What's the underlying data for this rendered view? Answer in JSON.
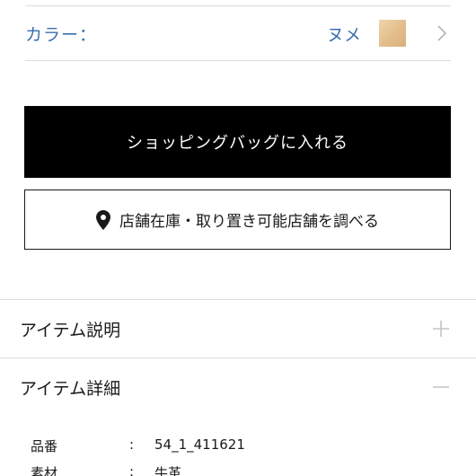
{
  "color_selector": {
    "label": "カラー：",
    "value": "ヌメ",
    "swatch_color": "#e2bd8b",
    "icon": "chevron-right-icon"
  },
  "actions": {
    "add_to_bag_label": "ショッピングバッグに入れる",
    "store_stock_label": "店舗在庫・取り置き可能店舗を調べる",
    "store_stock_icon": "location-pin-icon"
  },
  "accordions": [
    {
      "title": "アイテム説明",
      "state": "collapsed",
      "icon": "plus-icon"
    },
    {
      "title": "アイテム詳細",
      "state": "expanded",
      "icon": "minus-icon"
    }
  ],
  "item_details": [
    {
      "label": "品番",
      "separator": ":",
      "value": "54_1_411621"
    },
    {
      "label": "素材",
      "separator": ":",
      "value": "牛革"
    }
  ],
  "colors": {
    "accent_blue": "#3a6fae",
    "button_black": "#000000",
    "divider": "#dcdcdc"
  }
}
